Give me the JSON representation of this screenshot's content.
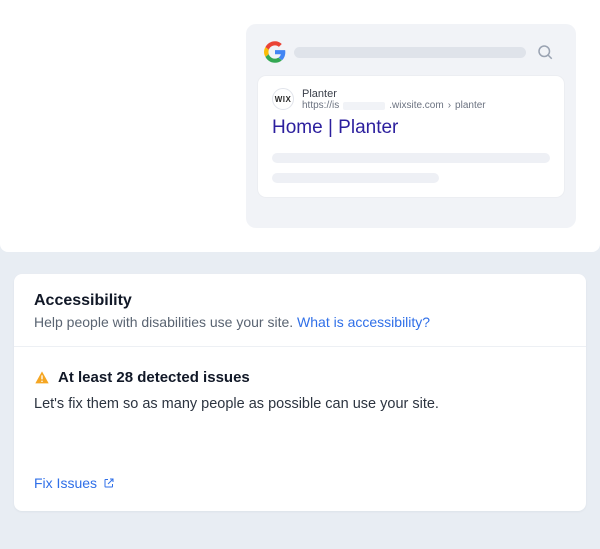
{
  "serp": {
    "favicon_label": "WIX",
    "site_name": "Planter",
    "url_prefix": "https://is",
    "url_suffix": ".wixsite.com",
    "url_path": "planter",
    "result_title": "Home | Planter"
  },
  "a11y": {
    "title": "Accessibility",
    "subtitle": "Help people with disabilities use your site.",
    "learn_more": "What is accessibility?",
    "issues_heading": "At least 28 detected issues",
    "issues_desc": "Let's fix them so as many people as possible can use your site.",
    "fix_label": "Fix Issues"
  },
  "icons": {
    "google": "google-logo-icon",
    "search": "search-icon",
    "warning": "warning-icon",
    "external": "external-link-icon"
  }
}
